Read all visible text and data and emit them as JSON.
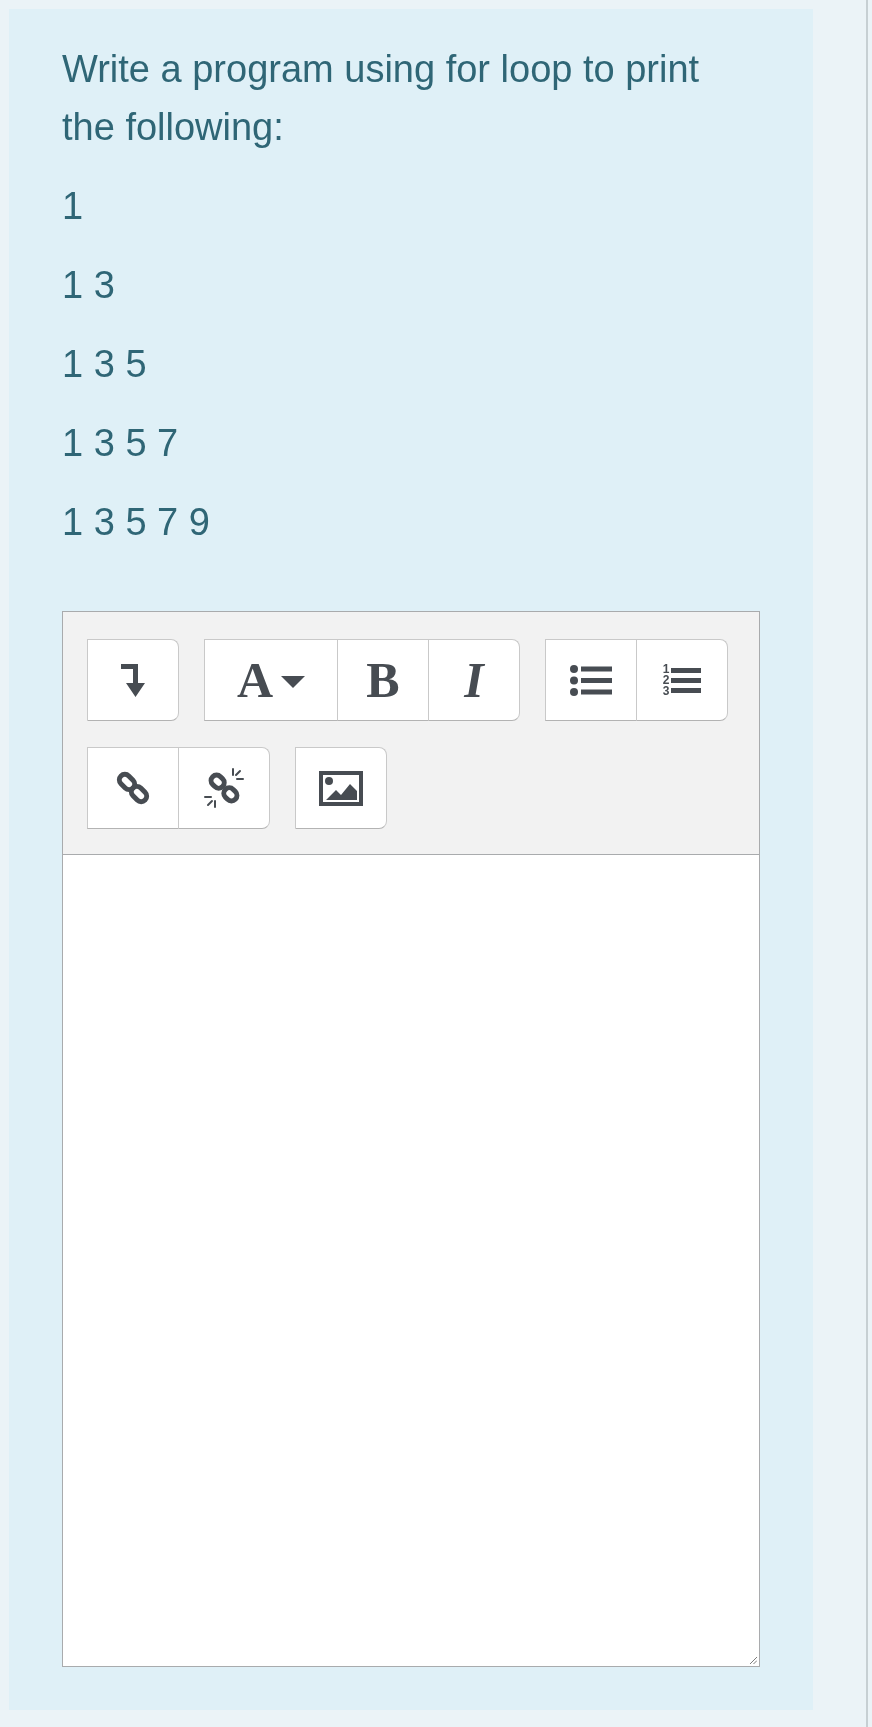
{
  "question": {
    "prompt": "Write a program using for loop to print the following:",
    "lines": [
      "1",
      "1 3",
      "1 3 5",
      "1 3 5 7",
      "1 3 5 7 9"
    ]
  },
  "editor": {
    "toolbar": [
      {
        "buttons": [
          {
            "kind": "more"
          }
        ]
      },
      {
        "buttons": [
          {
            "kind": "style",
            "label": "A"
          },
          {
            "kind": "bold",
            "label": "B"
          },
          {
            "kind": "italic",
            "label": "I"
          }
        ]
      },
      {
        "buttons": [
          {
            "kind": "bullets"
          },
          {
            "kind": "numbers",
            "digits": [
              "1",
              "2",
              "3"
            ]
          }
        ]
      },
      {
        "buttons": [
          {
            "kind": "link"
          },
          {
            "kind": "unlink"
          }
        ]
      },
      {
        "buttons": [
          {
            "kind": "image"
          }
        ]
      }
    ]
  }
}
